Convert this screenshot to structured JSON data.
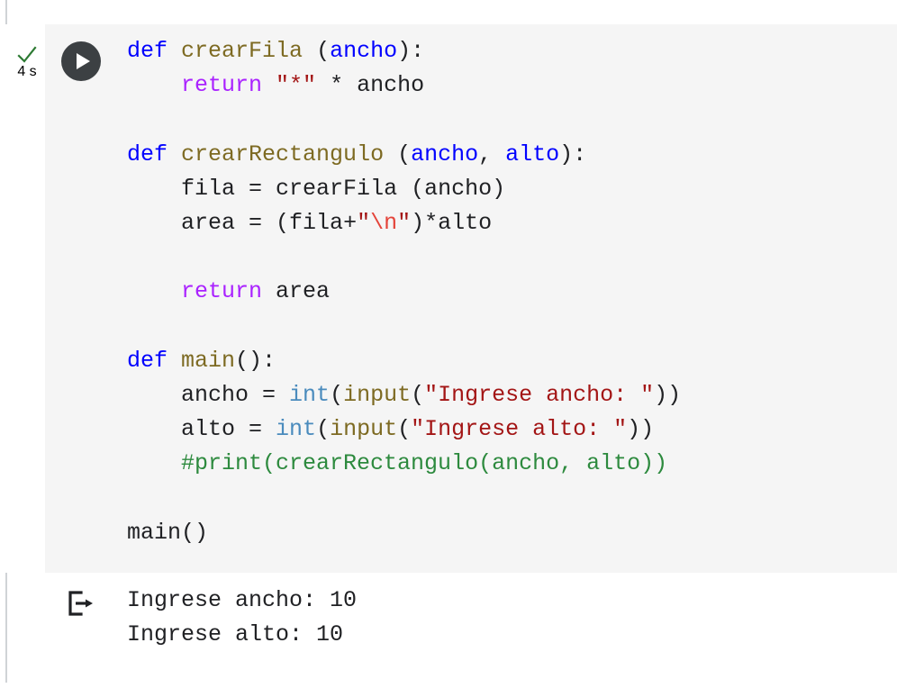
{
  "cell": {
    "status_icon": "check-icon",
    "execution_time": "4 s",
    "run_button_icon": "play-icon",
    "background_color": "#f5f5f5"
  },
  "code": {
    "language": "python",
    "lines": [
      {
        "id": "line-1",
        "text": "def crearFila (ancho):"
      },
      {
        "id": "line-2",
        "text": "    return \"*\" * ancho"
      },
      {
        "id": "line-3",
        "text": ""
      },
      {
        "id": "line-4",
        "text": "def crearRectangulo (ancho, alto):"
      },
      {
        "id": "line-5",
        "text": "    fila = crearFila (ancho)"
      },
      {
        "id": "line-6",
        "text": "    area = (fila+\"\\n\")*alto"
      },
      {
        "id": "line-7",
        "text": ""
      },
      {
        "id": "line-8",
        "text": "    return area"
      },
      {
        "id": "line-9",
        "text": ""
      },
      {
        "id": "line-10",
        "text": "def main():"
      },
      {
        "id": "line-11",
        "text": "    ancho = int(input(\"Ingrese ancho: \"))"
      },
      {
        "id": "line-12",
        "text": "    alto = int(input(\"Ingrese alto: \"))"
      },
      {
        "id": "line-13",
        "text": "    #print(crearRectangulo(ancho, alto))"
      },
      {
        "id": "line-14",
        "text": ""
      },
      {
        "id": "line-15",
        "text": "main()"
      }
    ],
    "tokens": {
      "keyword_def": "def",
      "keyword_return": "return",
      "fn_crearFila": "crearFila",
      "fn_crearRectangulo": "crearRectangulo",
      "fn_main": "main",
      "builtin_int": "int",
      "builtin_input": "input",
      "param_ancho": "ancho",
      "param_alto": "alto",
      "string_star": "\"*\"",
      "string_newline_open": "\"",
      "string_newline_esc": "\\n",
      "string_newline_close": "\"",
      "string_ingrese_ancho": "\"Ingrese ancho: \"",
      "string_ingrese_alto": "\"Ingrese alto: \"",
      "comment_print": "#print(crearRectangulo(ancho, alto))",
      "plain_fila": "fila",
      "plain_area": "area",
      "plain_call_main": "main()"
    }
  },
  "output": {
    "icon": "output-arrow-icon",
    "lines": [
      "Ingrese ancho: 10",
      "Ingrese alto: 10"
    ]
  },
  "colors": {
    "cell_bg": "#f5f5f5",
    "page_bg": "#ffffff",
    "keyword": "#0000ff",
    "keyword_flow": "#aa22ff",
    "function_name": "#7d6a22",
    "builtin": "#4a8bbd",
    "string": "#a31515",
    "escape": "#e4443a",
    "comment": "#2d8a3e",
    "text": "#202124",
    "status_check": "#2d7a33",
    "status_time": "#5f6368",
    "run_button": "#3c4043",
    "rail": "#d0d3d6"
  }
}
